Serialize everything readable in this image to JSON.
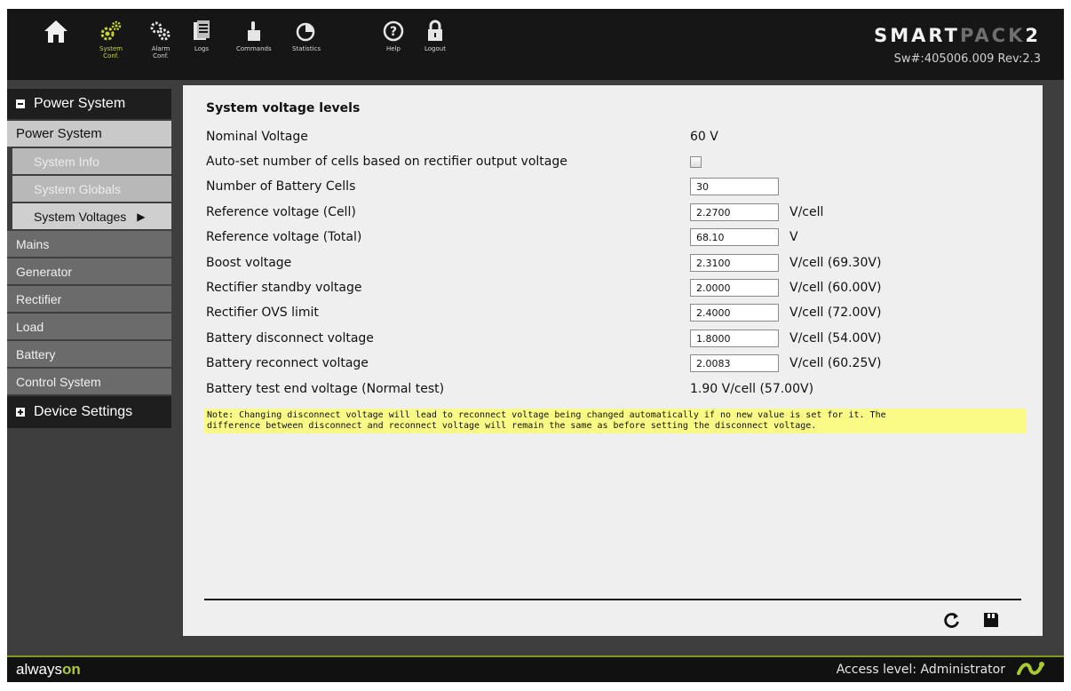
{
  "topbar": {
    "nav": [
      {
        "label": "",
        "icon": "home-icon"
      },
      {
        "label": "System\nConf.",
        "icon": "system-conf-icon"
      },
      {
        "label": "Alarm\nConf.",
        "icon": "alarm-conf-icon"
      },
      {
        "label": "Logs",
        "icon": "logs-icon"
      },
      {
        "label": "Commands",
        "icon": "commands-icon"
      },
      {
        "label": "Statistics",
        "icon": "statistics-icon"
      },
      {
        "label": "Help",
        "icon": "help-icon"
      },
      {
        "label": "Logout",
        "icon": "logout-icon"
      }
    ],
    "brand_part1": "SMART",
    "brand_part2": "PACK",
    "brand_part3": "2",
    "version": "Sw#:405006.009 Rev:2.3",
    "accent_color": "#c7d62f"
  },
  "sidebar": {
    "power_system_header": "Power System",
    "power_system_selected": "Power System",
    "subitems": [
      "System Info",
      "System Globals",
      "System Voltages"
    ],
    "items": [
      "Mains",
      "Generator",
      "Rectifier",
      "Load",
      "Battery",
      "Control System"
    ],
    "device_settings_header": "Device Settings",
    "current_arrow": "▶"
  },
  "main": {
    "title": "System voltage levels",
    "nominal": {
      "label": "Nominal Voltage",
      "value": "60 V"
    },
    "autoset": {
      "label": "Auto-set number of cells based on rectifier output voltage",
      "checked": false
    },
    "cells": {
      "label": "Number of Battery Cells",
      "value": "30"
    },
    "ref_cell": {
      "label": "Reference voltage (Cell)",
      "value": "2.2700",
      "unit": "V/cell"
    },
    "ref_total": {
      "label": "Reference voltage (Total)",
      "value": "68.10",
      "unit": "V"
    },
    "boost": {
      "label": "Boost voltage",
      "value": "2.3100",
      "unit": "V/cell (69.30V)"
    },
    "standby": {
      "label": "Rectifier standby voltage",
      "value": "2.0000",
      "unit": "V/cell (60.00V)"
    },
    "ovs": {
      "label": "Rectifier OVS limit",
      "value": "2.4000",
      "unit": "V/cell (72.00V)"
    },
    "disconnect": {
      "label": "Battery disconnect voltage",
      "value": "1.8000",
      "unit": "V/cell (54.00V)"
    },
    "reconnect": {
      "label": "Battery reconnect voltage",
      "value": "2.0083",
      "unit": "V/cell (60.25V)"
    },
    "test_end": {
      "label": "Battery test end voltage (Normal test)",
      "value": "1.90 V/cell (57.00V)"
    },
    "note_line1": "Note: Changing disconnect voltage will lead to reconnect voltage being changed automatically if no new value is set for it. The",
    "note_line2": "difference between disconnect and reconnect voltage will remain the same as before setting the disconnect voltage.",
    "note_color": "#fafa86",
    "actions": [
      {
        "icon": "refresh-icon"
      },
      {
        "icon": "save-icon"
      }
    ]
  },
  "bottombar": {
    "brand_always": "always",
    "brand_on": "on",
    "access": "Access level: Administrator",
    "logo_icon": "eltek-logo-icon"
  }
}
